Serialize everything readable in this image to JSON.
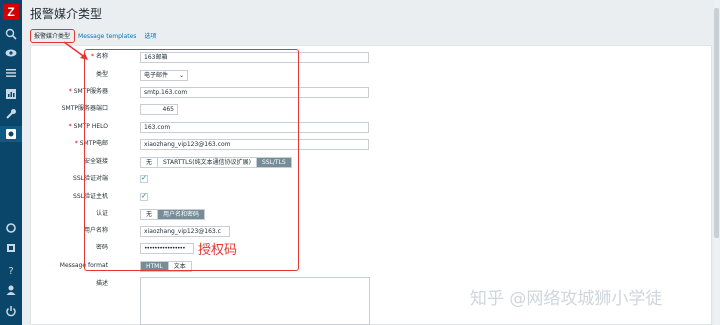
{
  "app": {
    "logo_text": "Z"
  },
  "header": {
    "title": "报警媒介类型"
  },
  "tabs": [
    {
      "label": "报警媒介类型"
    },
    {
      "label": "Message templates"
    },
    {
      "label": "选项"
    }
  ],
  "form": {
    "name": {
      "label": "名称",
      "value": "163邮箱"
    },
    "type": {
      "label": "类型",
      "value": "电子邮件"
    },
    "smtp_server": {
      "label": "SMTP服务器",
      "value": "smtp.163.com"
    },
    "smtp_port": {
      "label": "SMTP服务器端口",
      "value": "465"
    },
    "smtp_helo": {
      "label": "SMTP HELO",
      "value": "163.com"
    },
    "smtp_email": {
      "label": "SMTP电邮",
      "value": "xiaozhang_vip123@163.com"
    },
    "security": {
      "label": "安全链接",
      "options": [
        "无",
        "STARTTLS(纯文本通信协议扩展)",
        "SSL/TLS"
      ],
      "selected": "SSL/TLS"
    },
    "ssl_verify_peer": {
      "label": "SSL验证对端",
      "checked": true
    },
    "ssl_verify_host": {
      "label": "SSL验证主机",
      "checked": true
    },
    "auth": {
      "label": "认证",
      "options": [
        "无",
        "用户名和密码"
      ],
      "selected": "用户名和密码"
    },
    "username": {
      "label": "用户名称",
      "value": "xiaozhang_vip123@163.c"
    },
    "password": {
      "label": "密码",
      "value": "••••••••••••••••"
    },
    "message_format": {
      "label": "Message format",
      "options": [
        "HTML",
        "文本"
      ],
      "selected": "HTML"
    },
    "description": {
      "label": "描述",
      "value": ""
    }
  },
  "annotation": {
    "text": "授权码"
  },
  "watermark": {
    "text": "知乎 @网络攻城狮小学徒"
  },
  "colors": {
    "sidebar": "#0a466a",
    "highlight": "#e33734",
    "link": "#0275b8",
    "segment_on": "#768d99"
  },
  "sidebar_icons": [
    "search-icon",
    "eye-icon",
    "list-icon",
    "chart-icon",
    "wrench-icon",
    "gear-icon",
    "support-icon",
    "share-icon",
    "help-icon",
    "user-icon",
    "power-icon"
  ]
}
